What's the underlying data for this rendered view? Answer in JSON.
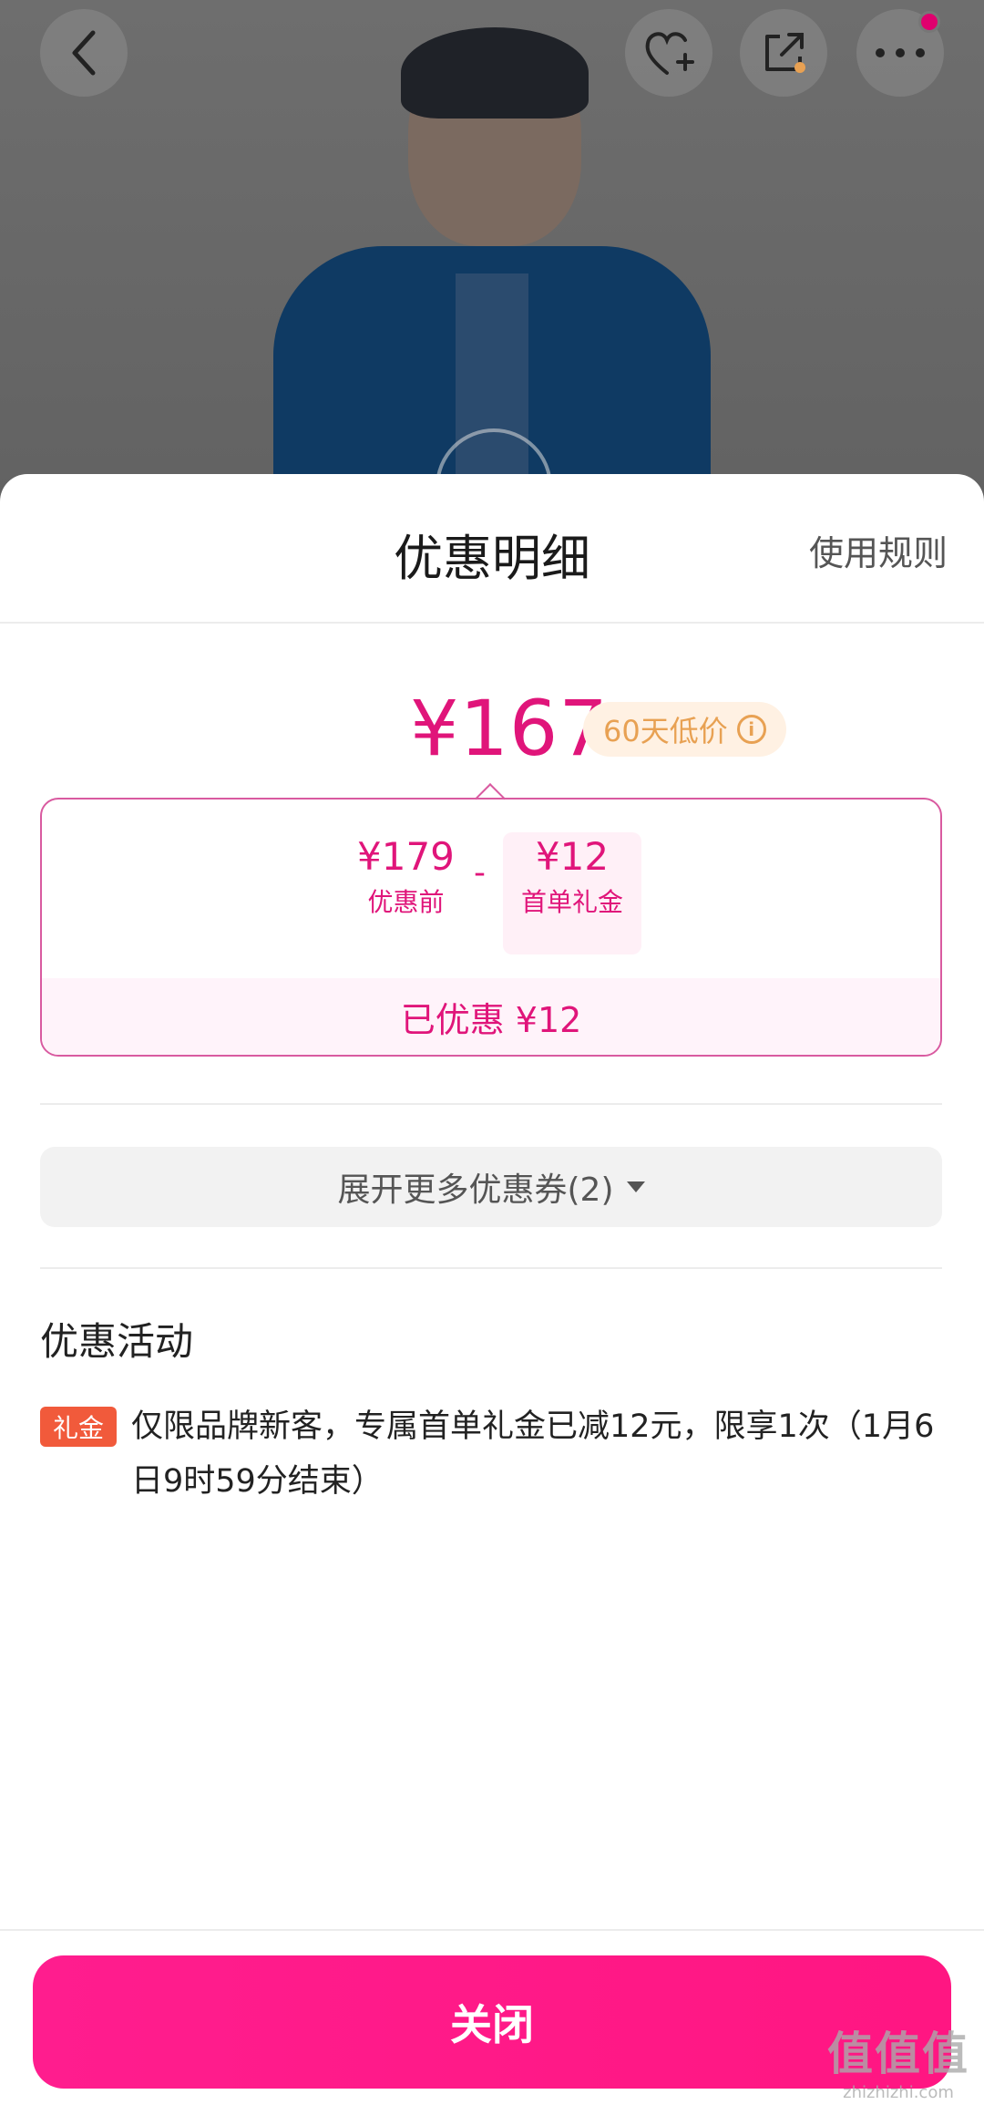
{
  "header": {
    "back_icon": "chevron-left-icon",
    "favorite_icon": "heart-plus-icon",
    "share_icon": "share-icon",
    "more_icon": "ellipsis-icon"
  },
  "sheet": {
    "title": "优惠明细",
    "rules_link": "使用规则"
  },
  "price": {
    "final": "¥167",
    "badge": "60天低价"
  },
  "calculation": {
    "original_value": "¥179",
    "original_label": "优惠前",
    "minus": "-",
    "gift_value": "¥12",
    "gift_label": "首单礼金",
    "saved_text": "已优惠 ¥12"
  },
  "expand": {
    "label": "展开更多优惠券(2)"
  },
  "activities": {
    "title": "优惠活动",
    "items": [
      {
        "tag": "礼金",
        "text": "仅限品牌新客，专属首单礼金已减12元，限享1次（1月6日9时59分结束）"
      }
    ]
  },
  "footer": {
    "close_label": "关闭"
  },
  "watermark": {
    "text": "值值值",
    "url": "zhizhizhi.com"
  },
  "colors": {
    "accent": "#e0157a",
    "badge_text": "#e8a153",
    "tag_bg": "#f15a3b",
    "close_bg": "#ff1d8e"
  }
}
